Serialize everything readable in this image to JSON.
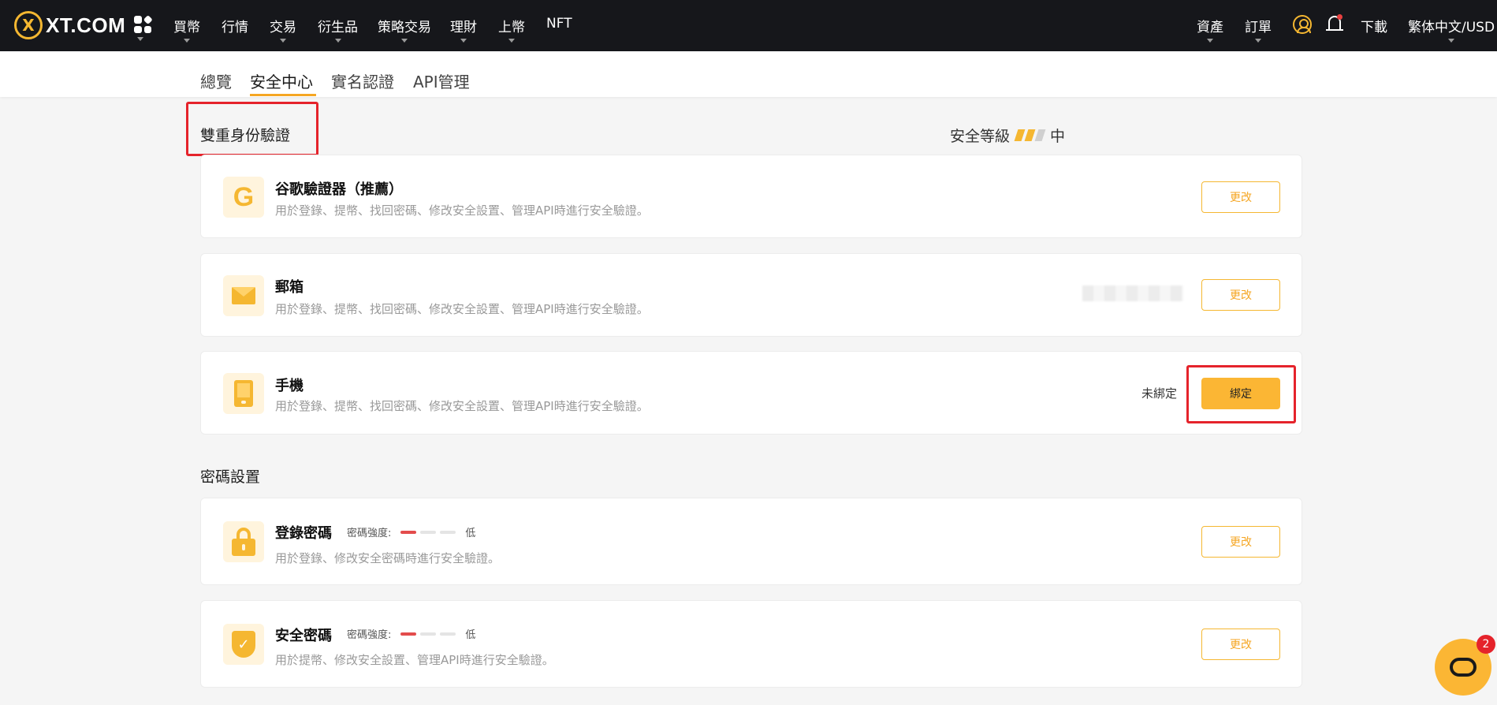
{
  "header": {
    "logo_mark": "X",
    "logo_text": "XT.COM",
    "nav": [
      {
        "label": "買幣",
        "has_dropdown": true
      },
      {
        "label": "行情",
        "has_dropdown": false
      },
      {
        "label": "交易",
        "has_dropdown": true
      },
      {
        "label": "衍生品",
        "has_dropdown": true
      },
      {
        "label": "策略交易",
        "has_dropdown": true
      },
      {
        "label": "理財",
        "has_dropdown": true
      },
      {
        "label": "上幣",
        "has_dropdown": true
      },
      {
        "label": "NFT",
        "has_dropdown": false
      }
    ],
    "right": {
      "assets": "資產",
      "orders": "訂單",
      "download": "下載",
      "language": "繁体中文/USD"
    }
  },
  "tabs": [
    {
      "label": "總覽",
      "active": false
    },
    {
      "label": "安全中心",
      "active": true
    },
    {
      "label": "實名認證",
      "active": false
    },
    {
      "label": "API管理",
      "active": false
    }
  ],
  "two_factor": {
    "title": "雙重身份驗證",
    "level_label": "安全等級",
    "level_value": "中",
    "level_filled": 2,
    "level_total": 3,
    "items": [
      {
        "title": "谷歌驗證器（推薦）",
        "desc": "用於登錄、提幣、找回密碼、修改安全設置、管理API時進行安全驗證。",
        "button": "更改",
        "icon": "google-authenticator-icon"
      },
      {
        "title": "郵箱",
        "desc": "用於登錄、提幣、找回密碼、修改安全設置、管理API時進行安全驗證。",
        "button": "更改",
        "icon": "mail-icon"
      },
      {
        "title": "手機",
        "desc": "用於登錄、提幣、找回密碼、修改安全設置、管理API時進行安全驗證。",
        "button": "綁定",
        "status": "未綁定",
        "icon": "phone-icon"
      }
    ]
  },
  "password": {
    "title": "密碼設置",
    "items": [
      {
        "title": "登錄密碼",
        "strength_label": "密碼強度:",
        "strength_value": "低",
        "strength_level": 1,
        "desc": "用於登錄、修改安全密碼時進行安全驗證。",
        "button": "更改",
        "icon": "lock-icon"
      },
      {
        "title": "安全密碼",
        "strength_label": "密碼強度:",
        "strength_value": "低",
        "strength_level": 1,
        "desc": "用於提幣、修改安全設置、管理API時進行安全驗證。",
        "button": "更改",
        "icon": "shield-icon"
      }
    ]
  },
  "chat": {
    "badge": "2"
  },
  "colors": {
    "accent": "#f5b731",
    "highlight_box": "#e5232b",
    "topbar": "#16171b"
  }
}
